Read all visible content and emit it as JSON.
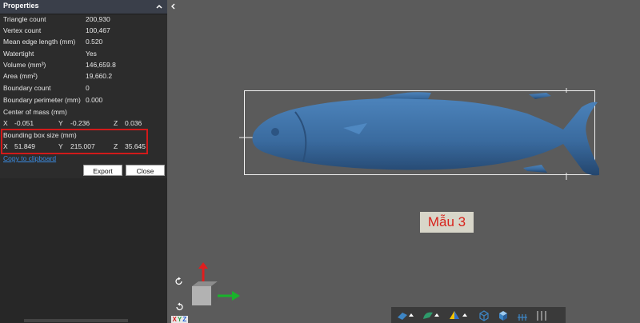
{
  "panel": {
    "title": "Properties",
    "stats": [
      {
        "label": "Triangle count",
        "value": "200,930"
      },
      {
        "label": "Vertex count",
        "value": "100,467"
      },
      {
        "label": "Mean edge length (mm)",
        "value": "0.520"
      },
      {
        "label": "Watertight",
        "value": "Yes"
      },
      {
        "label": "Volume (mm³)",
        "value": "146,659.8"
      },
      {
        "label": "Area (mm²)",
        "value": "19,660.2"
      },
      {
        "label": "Boundary count",
        "value": "0"
      },
      {
        "label": "Boundary perimeter (mm)",
        "value": "0.000"
      }
    ],
    "center_of_mass": {
      "label": "Center of mass (mm)",
      "x": "-0.051",
      "y": "-0.236",
      "z": "0.036"
    },
    "bounding_box": {
      "label": "Bounding box size (mm)",
      "x": "51.849",
      "y": "215.007",
      "z": "35.645"
    },
    "axis_labels": {
      "x": "X",
      "y": "Y",
      "z": "Z"
    },
    "copy_link": "Copy to clipboard",
    "export_button": "Export",
    "close_button": "Close"
  },
  "viewport": {
    "sample_label": "Mẫu 3",
    "gizmo_label": {
      "x": "X",
      "y": "Y",
      "z": "Z"
    }
  },
  "colors": {
    "model": "#3e6fa3",
    "highlight": "#d11a1a",
    "link": "#3b8be0",
    "label_text": "#d8221b"
  }
}
